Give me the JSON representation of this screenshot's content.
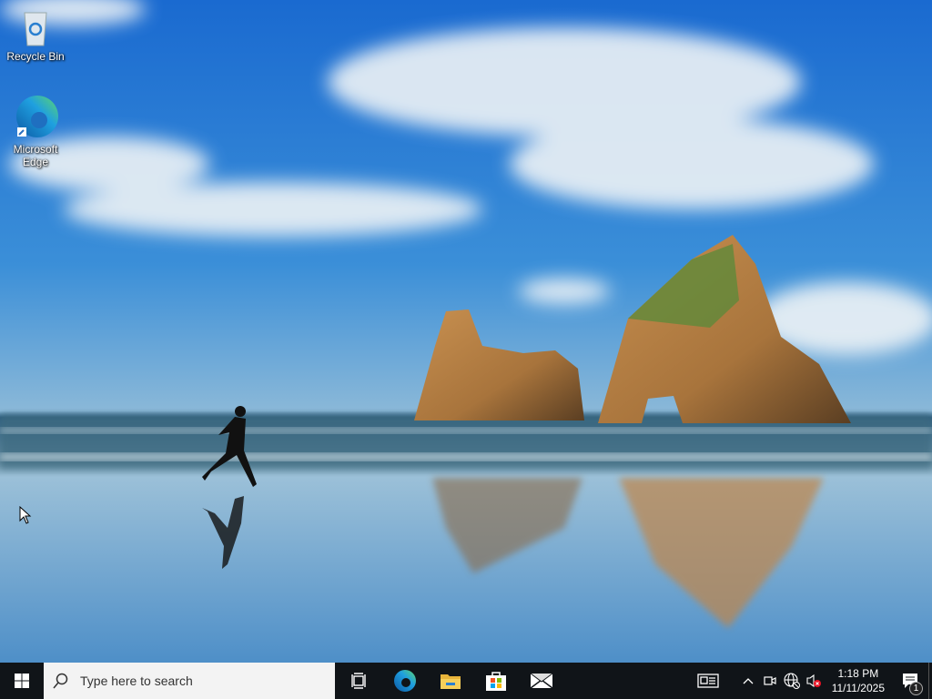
{
  "desktop": {
    "icons": [
      {
        "label": "Recycle Bin",
        "icon": "recycle-bin-icon"
      },
      {
        "label": "Microsoft Edge",
        "icon": "edge-icon"
      }
    ]
  },
  "taskbar": {
    "search_placeholder": "Type here to search",
    "apps": [
      "task-view-icon",
      "edge-icon",
      "file-explorer-icon",
      "microsoft-store-icon",
      "mail-icon"
    ],
    "clock": {
      "time": "1:18 PM",
      "date": "11/11/2025"
    },
    "notification_count": "1"
  }
}
